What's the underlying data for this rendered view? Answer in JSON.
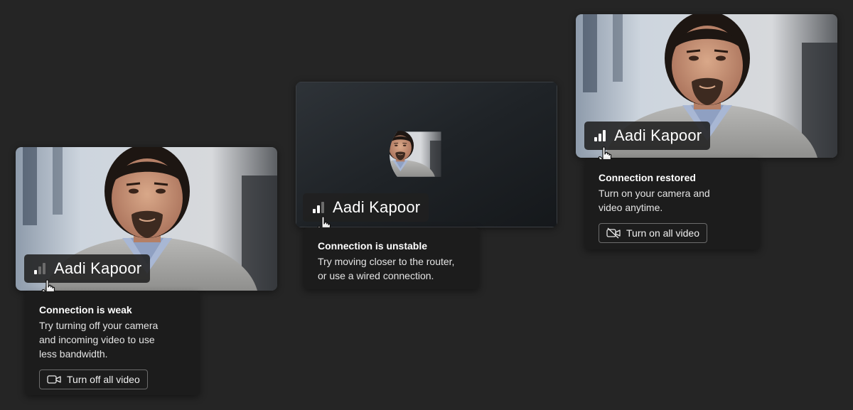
{
  "participant": {
    "name": "Aadi Kapoor"
  },
  "panels": [
    {
      "state": "weak",
      "signal_level": 1,
      "tooltip": {
        "title": "Connection is weak",
        "body": "Try turning off your camera\nand incoming video to use\nless bandwidth.",
        "button_label": "Turn off all video",
        "button_icon": "video-camera-icon"
      }
    },
    {
      "state": "unstable",
      "signal_level": 2,
      "tooltip": {
        "title": "Connection is unstable",
        "body": "Try moving closer to the router,\nor use a wired connection."
      }
    },
    {
      "state": "restored",
      "signal_level": 3,
      "tooltip": {
        "title": "Connection restored",
        "body": "Turn on your camera and\nvideo anytime.",
        "button_label": "Turn on all video",
        "button_icon": "video-camera-off-icon"
      }
    }
  ],
  "colors": {
    "background": "#252525",
    "signal_active": "#ffffff",
    "signal_inactive": "#6b6b6b",
    "tooltip_bg": "#1c1c1c"
  }
}
